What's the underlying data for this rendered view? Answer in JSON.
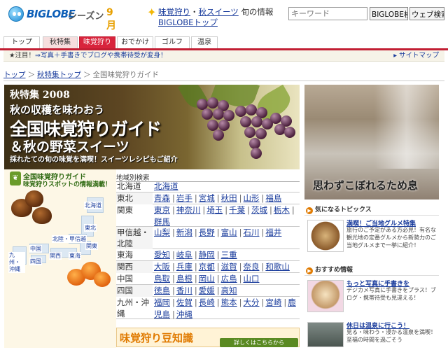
{
  "header": {
    "logo_name": "BIGLOBE",
    "logo_season": "シーズン",
    "logo_month": "9月",
    "links": [
      {
        "label": "味覚狩り"
      },
      {
        "label": "秋スイーツ"
      }
    ],
    "link_sep": "・",
    "plain_text": "旬の情報",
    "biglobe_link": "BIGLOBEトップ",
    "keyword_placeholder": "キーワード",
    "btn_biglobe": "BIGLOBE検索",
    "btn_web": "ウェブ検索"
  },
  "tabs": [
    "トップ",
    "秋特集",
    "味覚狩り",
    "おでかけ",
    "ゴルフ",
    "温泉"
  ],
  "notice": {
    "prefix": "★注目！",
    "link": "⇒写真＋手書きでブログや携帯待受が変身！",
    "sitemap": "サイトマップ"
  },
  "breadcrumb": {
    "items": [
      "トップ",
      "秋特集トップ"
    ],
    "sep": "＞",
    "current": "全国味覚狩りガイド"
  },
  "hero": {
    "line1": "秋特集 2008",
    "line2": "秋の収穫を味わおう",
    "line3": "全国味覚狩りガイド",
    "line4": "＆秋の野菜スイーツ",
    "line5": "採れたての旬の味覚を満喫！スイーツレシピもご紹介"
  },
  "map": {
    "badge_title": "全国味覚狩りガイド",
    "badge_sub": "味覚狩りスポットの情報満載！",
    "labels": [
      "北海道",
      "東北",
      "北陸・甲信越",
      "関東",
      "中国",
      "九州・沖縄",
      "四国",
      "関西",
      "東海"
    ]
  },
  "regions": {
    "title": "地域別検索",
    "rows": [
      {
        "name": "北海道",
        "prefs": [
          "北海道"
        ]
      },
      {
        "name": "東北",
        "prefs": [
          "青森",
          "岩手",
          "宮城",
          "秋田",
          "山形",
          "福島"
        ]
      },
      {
        "name": "関東",
        "prefs": [
          "東京",
          "神奈川",
          "埼玉",
          "千葉",
          "茨城",
          "栃木",
          "群馬"
        ]
      },
      {
        "name": "甲信越・北陸",
        "prefs": [
          "山梨",
          "新潟",
          "長野",
          "富山",
          "石川",
          "福井"
        ]
      },
      {
        "name": "東海",
        "prefs": [
          "愛知",
          "岐阜",
          "静岡",
          "三重"
        ]
      },
      {
        "name": "関西",
        "prefs": [
          "大阪",
          "兵庫",
          "京都",
          "滋賀",
          "奈良",
          "和歌山"
        ]
      },
      {
        "name": "中国",
        "prefs": [
          "鳥取",
          "島根",
          "岡山",
          "広島",
          "山口"
        ]
      },
      {
        "name": "四国",
        "prefs": [
          "徳島",
          "香川",
          "愛媛",
          "高知"
        ]
      },
      {
        "name": "九州・沖縄",
        "prefs": [
          "福岡",
          "佐賀",
          "長崎",
          "熊本",
          "大分",
          "宮崎",
          "鹿児島",
          "沖縄"
        ]
      }
    ],
    "mame_title": "味覚狩り豆知識",
    "mame_btn": "詳しくはこちらから"
  },
  "ad": {
    "text": "思わずこぼれるため息"
  },
  "topics": {
    "head": "気になるトピックス",
    "title": "満喫！ご当地グルメ特集",
    "desc": "旅行のご予定がある方必見！有名な観光地の定番グルメから新勢力のご当地グルメまで一挙に紹介！"
  },
  "recommend": {
    "head": "おすすめ情報",
    "items": [
      {
        "title": "もっと写真に手書きを",
        "desc": "デジカメ写真に手書きをプラス！ブログ・携帯待受も見違える！"
      },
      {
        "title": "休日は温泉に行こう！",
        "desc": "見る・味わう・浸かる温泉を満喫！至福の時間を過ごそう"
      }
    ]
  },
  "colors": {
    "accent": "#c21e33",
    "link": "#1a3c9c"
  }
}
